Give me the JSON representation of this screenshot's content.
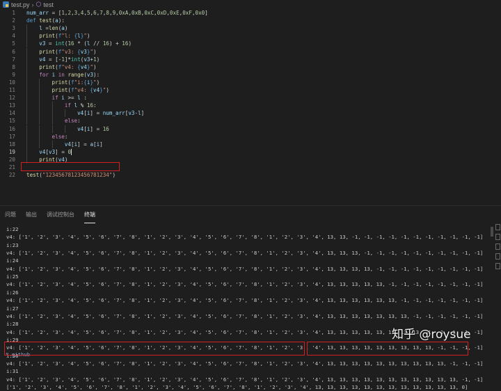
{
  "breadcrumb": {
    "file": "test.py",
    "separator": "›",
    "symbol": "test"
  },
  "editor": {
    "active_line": 19,
    "highlighted_line": 22,
    "lines": [
      {
        "n": "1",
        "indent": 0,
        "text": "num_arr = [1,2,3,4,5,6,7,8,9,0xA,0xB,0xC,0xD,0xE,0xF,0x0]"
      },
      {
        "n": "2",
        "indent": 0,
        "text": "def test(a):"
      },
      {
        "n": "3",
        "indent": 1,
        "text": "l =len(a)"
      },
      {
        "n": "4",
        "indent": 1,
        "text": "print(f\"l: {l}\")"
      },
      {
        "n": "5",
        "indent": 1,
        "text": "v3 = int(16 * (l // 16) + 16)"
      },
      {
        "n": "6",
        "indent": 1,
        "text": "print(f\"v3: {v3}\")"
      },
      {
        "n": "7",
        "indent": 1,
        "text": "v4 = [-1]*int(v3+1)"
      },
      {
        "n": "8",
        "indent": 1,
        "text": "print(f\"v4: {v4}\")"
      },
      {
        "n": "9",
        "indent": 1,
        "text": "for i in range(v3):"
      },
      {
        "n": "10",
        "indent": 2,
        "text": "print(f\"i:{i}\")"
      },
      {
        "n": "11",
        "indent": 2,
        "text": "print(f\"v4: {v4}\")"
      },
      {
        "n": "12",
        "indent": 2,
        "text": "if i >= l :"
      },
      {
        "n": "13",
        "indent": 3,
        "text": "if l % 16:"
      },
      {
        "n": "14",
        "indent": 4,
        "text": "v4[i] = num_arr[v3-l]"
      },
      {
        "n": "15",
        "indent": 3,
        "text": "else:"
      },
      {
        "n": "16",
        "indent": 4,
        "text": "v4[i] = 16"
      },
      {
        "n": "17",
        "indent": 2,
        "text": "else:"
      },
      {
        "n": "18",
        "indent": 3,
        "text": "v4[i] = a[i]"
      },
      {
        "n": "19",
        "indent": 1,
        "text": "v4[v3] = 0"
      },
      {
        "n": "20",
        "indent": 1,
        "text": "print(v4)"
      },
      {
        "n": "21",
        "indent": 0,
        "text": ""
      },
      {
        "n": "22",
        "indent": 0,
        "text": "test(\"12345678123456781234\")"
      }
    ]
  },
  "panel": {
    "tabs": [
      {
        "label": "问题",
        "active": false
      },
      {
        "label": "输出",
        "active": false
      },
      {
        "label": "调试控制台",
        "active": false
      },
      {
        "label": "终端",
        "active": true
      }
    ]
  },
  "terminal": {
    "lines": [
      "i:22",
      "v4: ['1', '2', '3', '4', '5', '6', '7', '8', '1', '2', '3', '4', '5', '6', '7', '8', '1', '2', '3', '4', 13, 13, -1, -1, -1, -1, -1, -1, -1, -1, -1, -1, -1]",
      "i:23",
      "v4: ['1', '2', '3', '4', '5', '6', '7', '8', '1', '2', '3', '4', '5', '6', '7', '8', '1', '2', '3', '4', 13, 13, 13, -1, -1, -1, -1, -1, -1, -1, -1, -1, -1]",
      "i:24",
      "v4: ['1', '2', '3', '4', '5', '6', '7', '8', '1', '2', '3', '4', '5', '6', '7', '8', '1', '2', '3', '4', 13, 13, 13, 13, -1, -1, -1, -1, -1, -1, -1, -1, -1]",
      "i:25",
      "v4: ['1', '2', '3', '4', '5', '6', '7', '8', '1', '2', '3', '4', '5', '6', '7', '8', '1', '2', '3', '4', 13, 13, 13, 13, 13, -1, -1, -1, -1, -1, -1, -1, -1]",
      "i:26",
      "v4: ['1', '2', '3', '4', '5', '6', '7', '8', '1', '2', '3', '4', '5', '6', '7', '8', '1', '2', '3', '4', 13, 13, 13, 13, 13, 13, -1, -1, -1, -1, -1, -1, -1]",
      "i:27",
      "v4: ['1', '2', '3', '4', '5', '6', '7', '8', '1', '2', '3', '4', '5', '6', '7', '8', '1', '2', '3', '4', 13, 13, 13, 13, 13, 13, 13, -1, -1, -1, -1, -1, -1]",
      "i:28",
      "v4: ['1', '2', '3', '4', '5', '6', '7', '8', '1', '2', '3', '4', '5', '6', '7', '8', '1', '2', '3', '4', 13, 13, 13, 13, 13, 13, 13, 13, -1, -1, -1, -1, -1]",
      "i:29",
      "v4: ['1', '2', '3', '4', '5', '6', '7', '8', '1', '2', '3', '4', '5', '6', '7', '8', '1', '2', '3', '4', 13, 13, 13, 13, 13, 13, 13, 13, 13, -1, -1, -1, -1]",
      "i:30",
      "v4: ['1', '2', '3', '4', '5', '6', '7', '8', '1', '2', '3', '4', '5', '6', '7', '8', '1', '2', '3', '4', 13, 13, 13, 13, 13, 13, 13, 13, 13, 13, -1, -1, -1]",
      "i:31",
      "v4: ['1', '2', '3', '4', '5', '6', '7', '8', '1', '2', '3', '4', '5', '6', '7', '8', '1', '2', '3', '4', 13, 13, 13, 13, 13, 13, 13, 13, 13, 13, 13, -1, -1]",
      "['1', '2', '3', '4', '5', '6', '7', '8', '1', '2', '3', '4', '5', '6', '7', '8', '1', '2', '3', '4', 13, 13, 13, 13, 13, 13, 13, 13, 13, 13, 13, 13, 0]"
    ],
    "github_label": "github"
  },
  "watermark": "知乎 @roysue",
  "colors": {
    "background": "#1e1e1e",
    "highlight_box": "#d32020",
    "keyword": "#569cd6",
    "function": "#dcdcaa",
    "string": "#ce9178"
  }
}
